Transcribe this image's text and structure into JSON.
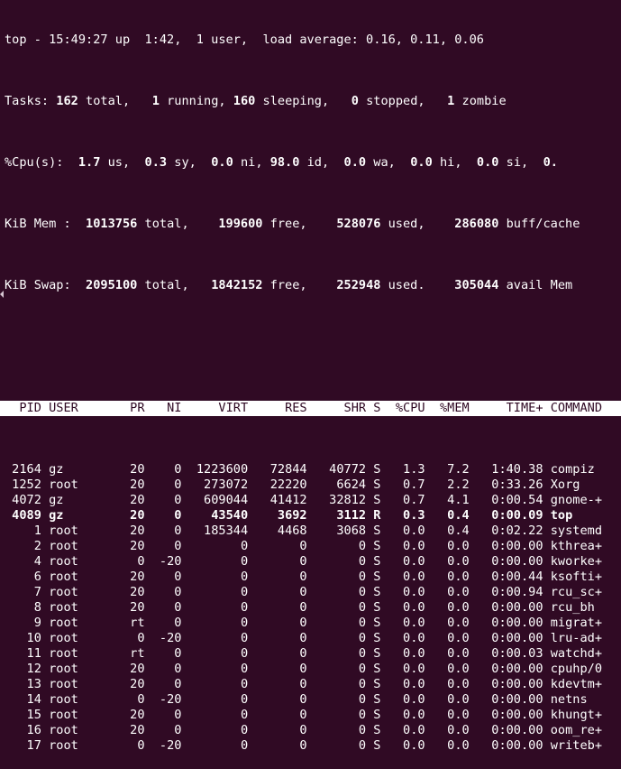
{
  "summary": {
    "top_line": {
      "prefix": "top - 15:49:27 up  1:42,  1 user,  load average: 0.16, 0.11, 0.06"
    },
    "tasks": {
      "label": "Tasks:",
      "total": "162",
      "total_label": " total,",
      "running": "1",
      "running_label": " running,",
      "sleeping": "160",
      "sleeping_label": " sleeping,",
      "stopped": "0",
      "stopped_label": " stopped,",
      "zombie": "1",
      "zombie_label": " zombie"
    },
    "cpu": {
      "label": "%Cpu(s):",
      "us": "1.7",
      "sy": "0.3",
      "ni": "0.0",
      "id": "98.0",
      "wa": "0.0",
      "hi": "0.0",
      "si": "0.0",
      "st": "0."
    },
    "mem": {
      "label": "KiB Mem :",
      "total": "1013756",
      "free": "199600",
      "used": "528076",
      "buff": "286080",
      "buff_label": " buff/cache"
    },
    "swap": {
      "label": "KiB Swap:",
      "total": "2095100",
      "free": "1842152",
      "used": "252948",
      "avail": "305044",
      "avail_label": " avail Mem"
    }
  },
  "table": {
    "columns": [
      "PID",
      "USER",
      "PR",
      "NI",
      "VIRT",
      "RES",
      "SHR",
      "S",
      "%CPU",
      "%MEM",
      "TIME+",
      "COMMAND"
    ],
    "rows": [
      {
        "pid": "2164",
        "user": "gz",
        "pr": "20",
        "ni": "0",
        "virt": "1223600",
        "res": "72844",
        "shr": "40772",
        "s": "S",
        "cpu": "1.3",
        "mem": "7.2",
        "time": "1:40.38",
        "cmd": "compiz",
        "bold": false
      },
      {
        "pid": "1252",
        "user": "root",
        "pr": "20",
        "ni": "0",
        "virt": "273072",
        "res": "22220",
        "shr": "6624",
        "s": "S",
        "cpu": "0.7",
        "mem": "2.2",
        "time": "0:33.26",
        "cmd": "Xorg",
        "bold": false
      },
      {
        "pid": "4072",
        "user": "gz",
        "pr": "20",
        "ni": "0",
        "virt": "609044",
        "res": "41412",
        "shr": "32812",
        "s": "S",
        "cpu": "0.7",
        "mem": "4.1",
        "time": "0:00.54",
        "cmd": "gnome-+",
        "bold": false
      },
      {
        "pid": "4089",
        "user": "gz",
        "pr": "20",
        "ni": "0",
        "virt": "43540",
        "res": "3692",
        "shr": "3112",
        "s": "R",
        "cpu": "0.3",
        "mem": "0.4",
        "time": "0:00.09",
        "cmd": "top",
        "bold": true
      },
      {
        "pid": "1",
        "user": "root",
        "pr": "20",
        "ni": "0",
        "virt": "185344",
        "res": "4468",
        "shr": "3068",
        "s": "S",
        "cpu": "0.0",
        "mem": "0.4",
        "time": "0:02.22",
        "cmd": "systemd",
        "bold": false
      },
      {
        "pid": "2",
        "user": "root",
        "pr": "20",
        "ni": "0",
        "virt": "0",
        "res": "0",
        "shr": "0",
        "s": "S",
        "cpu": "0.0",
        "mem": "0.0",
        "time": "0:00.00",
        "cmd": "kthrea+",
        "bold": false
      },
      {
        "pid": "4",
        "user": "root",
        "pr": "0",
        "ni": "-20",
        "virt": "0",
        "res": "0",
        "shr": "0",
        "s": "S",
        "cpu": "0.0",
        "mem": "0.0",
        "time": "0:00.00",
        "cmd": "kworke+",
        "bold": false
      },
      {
        "pid": "6",
        "user": "root",
        "pr": "20",
        "ni": "0",
        "virt": "0",
        "res": "0",
        "shr": "0",
        "s": "S",
        "cpu": "0.0",
        "mem": "0.0",
        "time": "0:00.44",
        "cmd": "ksofti+",
        "bold": false
      },
      {
        "pid": "7",
        "user": "root",
        "pr": "20",
        "ni": "0",
        "virt": "0",
        "res": "0",
        "shr": "0",
        "s": "S",
        "cpu": "0.0",
        "mem": "0.0",
        "time": "0:00.94",
        "cmd": "rcu_sc+",
        "bold": false
      },
      {
        "pid": "8",
        "user": "root",
        "pr": "20",
        "ni": "0",
        "virt": "0",
        "res": "0",
        "shr": "0",
        "s": "S",
        "cpu": "0.0",
        "mem": "0.0",
        "time": "0:00.00",
        "cmd": "rcu_bh",
        "bold": false
      },
      {
        "pid": "9",
        "user": "root",
        "pr": "rt",
        "ni": "0",
        "virt": "0",
        "res": "0",
        "shr": "0",
        "s": "S",
        "cpu": "0.0",
        "mem": "0.0",
        "time": "0:00.00",
        "cmd": "migrat+",
        "bold": false
      },
      {
        "pid": "10",
        "user": "root",
        "pr": "0",
        "ni": "-20",
        "virt": "0",
        "res": "0",
        "shr": "0",
        "s": "S",
        "cpu": "0.0",
        "mem": "0.0",
        "time": "0:00.00",
        "cmd": "lru-ad+",
        "bold": false
      },
      {
        "pid": "11",
        "user": "root",
        "pr": "rt",
        "ni": "0",
        "virt": "0",
        "res": "0",
        "shr": "0",
        "s": "S",
        "cpu": "0.0",
        "mem": "0.0",
        "time": "0:00.03",
        "cmd": "watchd+",
        "bold": false
      },
      {
        "pid": "12",
        "user": "root",
        "pr": "20",
        "ni": "0",
        "virt": "0",
        "res": "0",
        "shr": "0",
        "s": "S",
        "cpu": "0.0",
        "mem": "0.0",
        "time": "0:00.00",
        "cmd": "cpuhp/0",
        "bold": false
      },
      {
        "pid": "13",
        "user": "root",
        "pr": "20",
        "ni": "0",
        "virt": "0",
        "res": "0",
        "shr": "0",
        "s": "S",
        "cpu": "0.0",
        "mem": "0.0",
        "time": "0:00.00",
        "cmd": "kdevtm+",
        "bold": false
      },
      {
        "pid": "14",
        "user": "root",
        "pr": "0",
        "ni": "-20",
        "virt": "0",
        "res": "0",
        "shr": "0",
        "s": "S",
        "cpu": "0.0",
        "mem": "0.0",
        "time": "0:00.00",
        "cmd": "netns",
        "bold": false
      },
      {
        "pid": "15",
        "user": "root",
        "pr": "20",
        "ni": "0",
        "virt": "0",
        "res": "0",
        "shr": "0",
        "s": "S",
        "cpu": "0.0",
        "mem": "0.0",
        "time": "0:00.00",
        "cmd": "khungt+",
        "bold": false
      },
      {
        "pid": "16",
        "user": "root",
        "pr": "20",
        "ni": "0",
        "virt": "0",
        "res": "0",
        "shr": "0",
        "s": "S",
        "cpu": "0.0",
        "mem": "0.0",
        "time": "0:00.00",
        "cmd": "oom_re+",
        "bold": false
      },
      {
        "pid": "17",
        "user": "root",
        "pr": "0",
        "ni": "-20",
        "virt": "0",
        "res": "0",
        "shr": "0",
        "s": "S",
        "cpu": "0.0",
        "mem": "0.0",
        "time": "0:00.00",
        "cmd": "writeb+",
        "bold": false
      }
    ]
  },
  "colors": {
    "background": "#300a24",
    "foreground": "#ffffff",
    "header_background": "#ffffff",
    "header_foreground": "#300a24"
  }
}
